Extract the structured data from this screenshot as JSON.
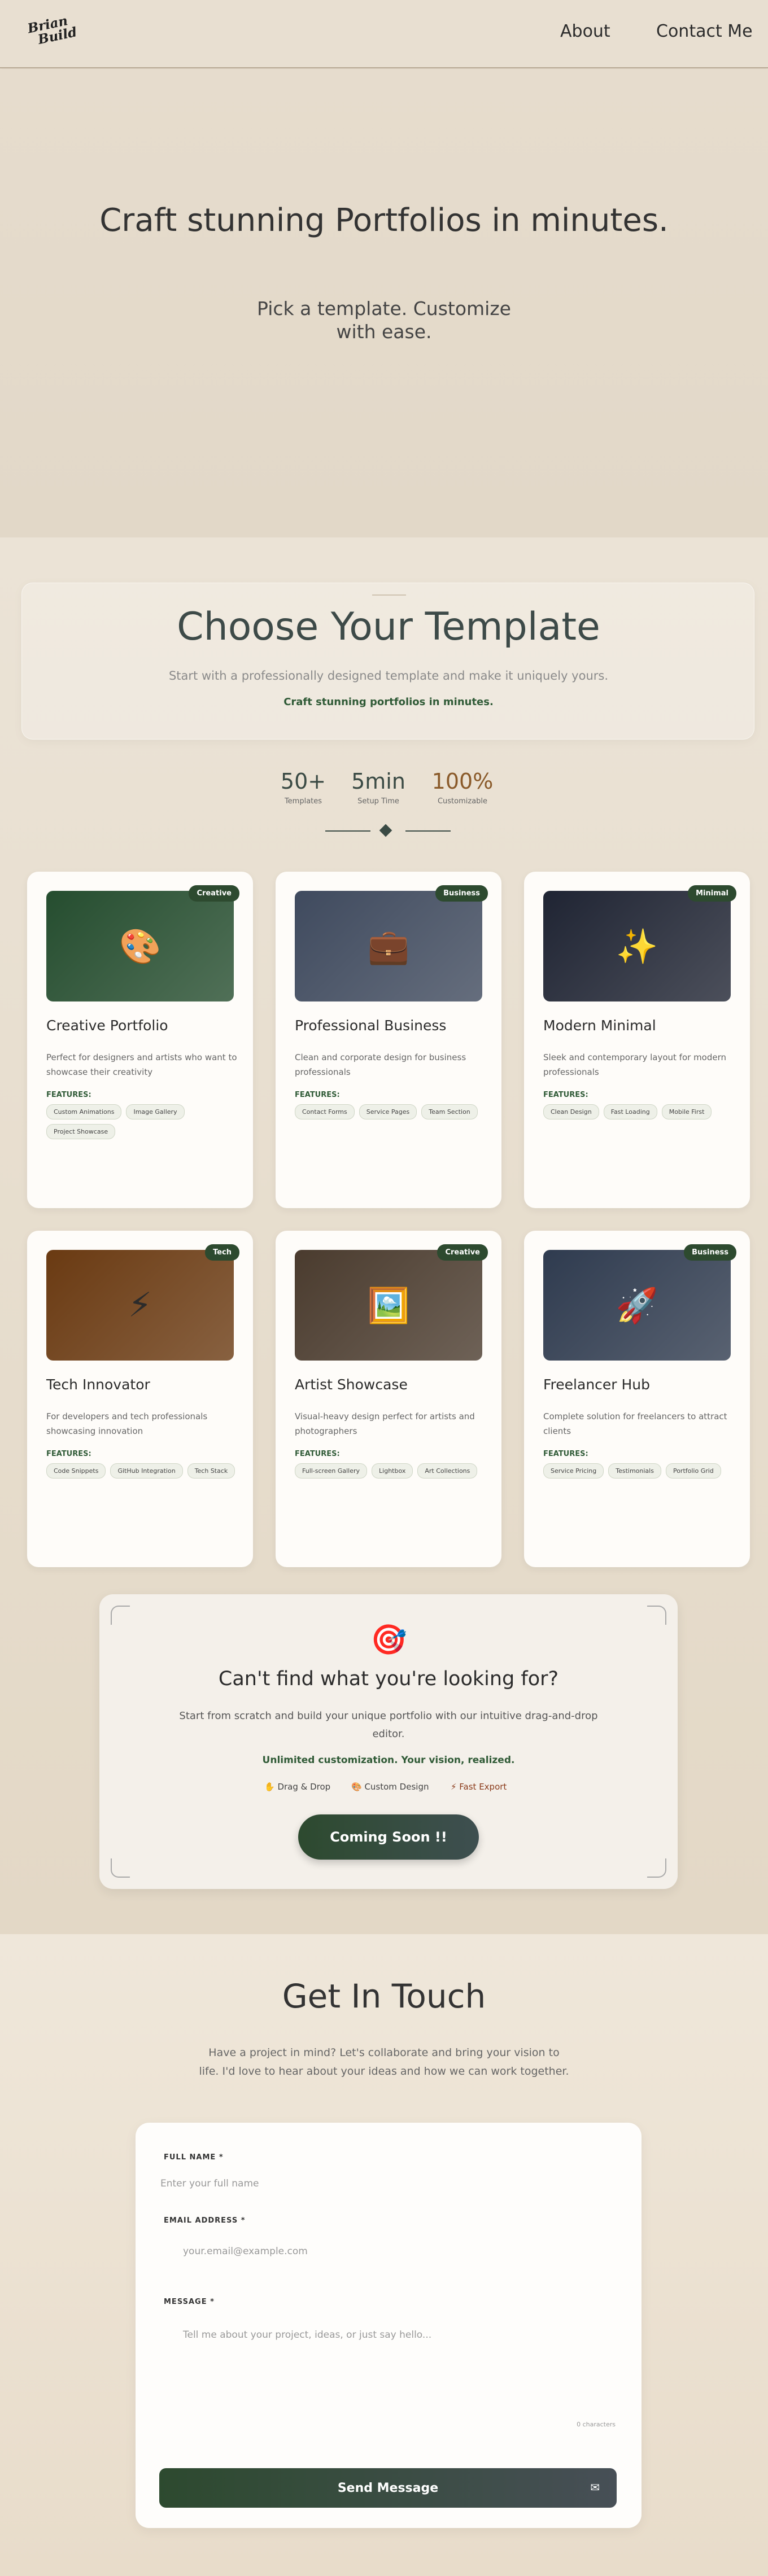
{
  "nav": {
    "logo_line1": "Brian",
    "logo_line2": "Build",
    "about": "About",
    "contact": "Contact Me"
  },
  "hero": {
    "title": "Craft stunning Portfolios in minutes.",
    "subtitle": "Pick a template. Customize with ease."
  },
  "templates": {
    "heading": "Choose Your Template",
    "subheading": "Start with a professionally designed template and make it uniquely yours.",
    "tagline": "Craft stunning portfolios in minutes.",
    "stats": [
      {
        "value": "50+",
        "label": "Templates"
      },
      {
        "value": "5min",
        "label": "Setup Time"
      },
      {
        "value": "100%",
        "label": "Customizable"
      }
    ],
    "features_label": "FEATURES:",
    "cards": [
      {
        "badge": "Creative",
        "icon": "🎨",
        "title": "Creative Portfolio",
        "desc": "Perfect for designers and artists who want to showcase their creativity",
        "features": [
          "Custom Animations",
          "Image Gallery",
          "Project Showcase"
        ],
        "color": "#254d2f"
      },
      {
        "badge": "Business",
        "icon": "💼",
        "title": "Professional Business",
        "desc": "Clean and corporate design for business professionals",
        "features": [
          "Contact Forms",
          "Service Pages",
          "Team Section"
        ],
        "color": "#3f4a5e"
      },
      {
        "badge": "Minimal",
        "icon": "✨",
        "title": "Modern Minimal",
        "desc": "Sleek and contemporary layout for modern professionals",
        "features": [
          "Clean Design",
          "Fast Loading",
          "Mobile First"
        ],
        "color": "#1f2433"
      },
      {
        "badge": "Tech",
        "icon": "⚡",
        "title": "Tech Innovator",
        "desc": "For developers and tech professionals showcasing innovation",
        "features": [
          "Code Snippets",
          "GitHub Integration",
          "Tech Stack"
        ],
        "color": "#6a3a12"
      },
      {
        "badge": "Creative",
        "icon": "🖼️",
        "title": "Artist Showcase",
        "desc": "Visual-heavy design perfect for artists and photographers",
        "features": [
          "Full-screen Gallery",
          "Lightbox",
          "Art Collections"
        ],
        "color": "#4a3b2e"
      },
      {
        "badge": "Business",
        "icon": "🚀",
        "title": "Freelancer Hub",
        "desc": "Complete solution for freelancers to attract clients",
        "features": [
          "Service Pricing",
          "Testimonials",
          "Portfolio Grid"
        ],
        "color": "#2f3b4f"
      }
    ]
  },
  "custom": {
    "icon": "🎯",
    "title": "Can't find what you're looking for?",
    "desc": "Start from scratch and build your unique portfolio with our intuitive drag-and-drop editor.",
    "highlight": "Unlimited customization. Your vision, realized.",
    "features": [
      "✋ Drag & Drop",
      "🎨 Custom Design",
      "⚡ Fast Export"
    ],
    "button": "Coming Soon !!"
  },
  "contact": {
    "title": "Get In Touch",
    "desc": "Have a project in mind? Let's collaborate and bring your vision to life. I'd love to hear about your ideas and how we can work together.",
    "name_label": "FULL NAME *",
    "name_placeholder": "Enter your full name",
    "email_label": "EMAIL ADDRESS *",
    "email_placeholder": "your.email@example.com",
    "message_label": "MESSAGE *",
    "message_placeholder": "Tell me about your project, ideas, or just say hello...",
    "counter": "0 characters",
    "send": "Send Message"
  }
}
